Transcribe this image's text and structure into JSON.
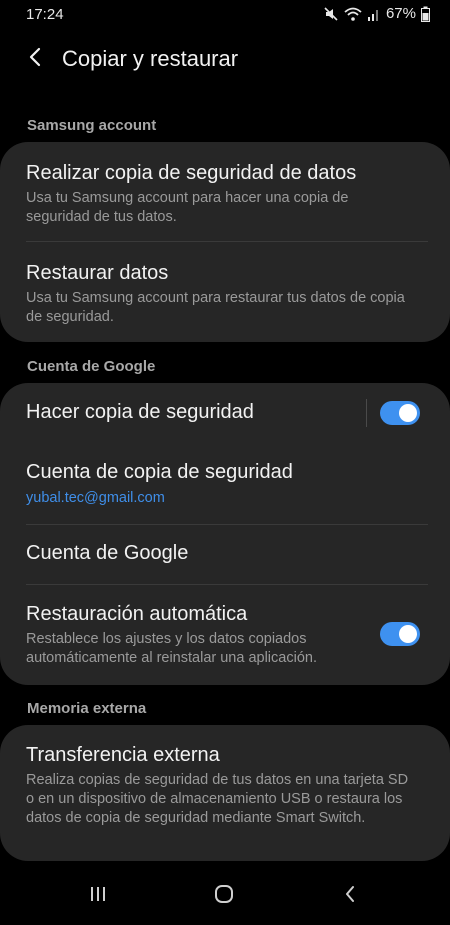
{
  "status": {
    "time": "17:24",
    "battery": "67%",
    "icons": [
      "mute-icon",
      "wifi-icon",
      "signal-icon",
      "battery-icon"
    ]
  },
  "header": {
    "title": "Copiar y restaurar",
    "back_icon": "chevron-left-icon"
  },
  "sections": {
    "samsung": {
      "label": "Samsung account",
      "items": [
        {
          "title": "Realizar copia de seguridad de datos",
          "subtitle": "Usa tu Samsung account para hacer una copia de seguridad de tus datos."
        },
        {
          "title": "Restaurar datos",
          "subtitle": "Usa tu Samsung account para restaurar tus datos de copia de seguridad."
        }
      ]
    },
    "google": {
      "label": "Cuenta de Google",
      "items": [
        {
          "title": "Hacer copia de seguridad",
          "toggle": true
        },
        {
          "title": "Cuenta de copia de seguridad",
          "subtitle": "yubal.tec@gmail.com"
        },
        {
          "title": "Cuenta de Google"
        },
        {
          "title": "Restauración automática",
          "subtitle": "Restablece los ajustes y los datos copiados automáticamente al reinstalar una aplicación.",
          "toggle": true
        }
      ]
    },
    "external": {
      "label": "Memoria externa",
      "items": [
        {
          "title": "Transferencia externa",
          "subtitle": "Realiza copias de seguridad de tus datos en una tarjeta SD o en un dispositivo de almacenamiento USB o restaura los datos de copia de seguridad mediante Smart Switch."
        }
      ]
    }
  },
  "navbar": {
    "icons": [
      "recents-icon",
      "home-icon",
      "back-icon"
    ]
  },
  "colors": {
    "background": "#000000",
    "card": "#262626",
    "accent": "#3e91f0",
    "link": "#3f8ee8",
    "section_label": "#a8a8a8",
    "secondary_text": "#9a9a9a"
  }
}
